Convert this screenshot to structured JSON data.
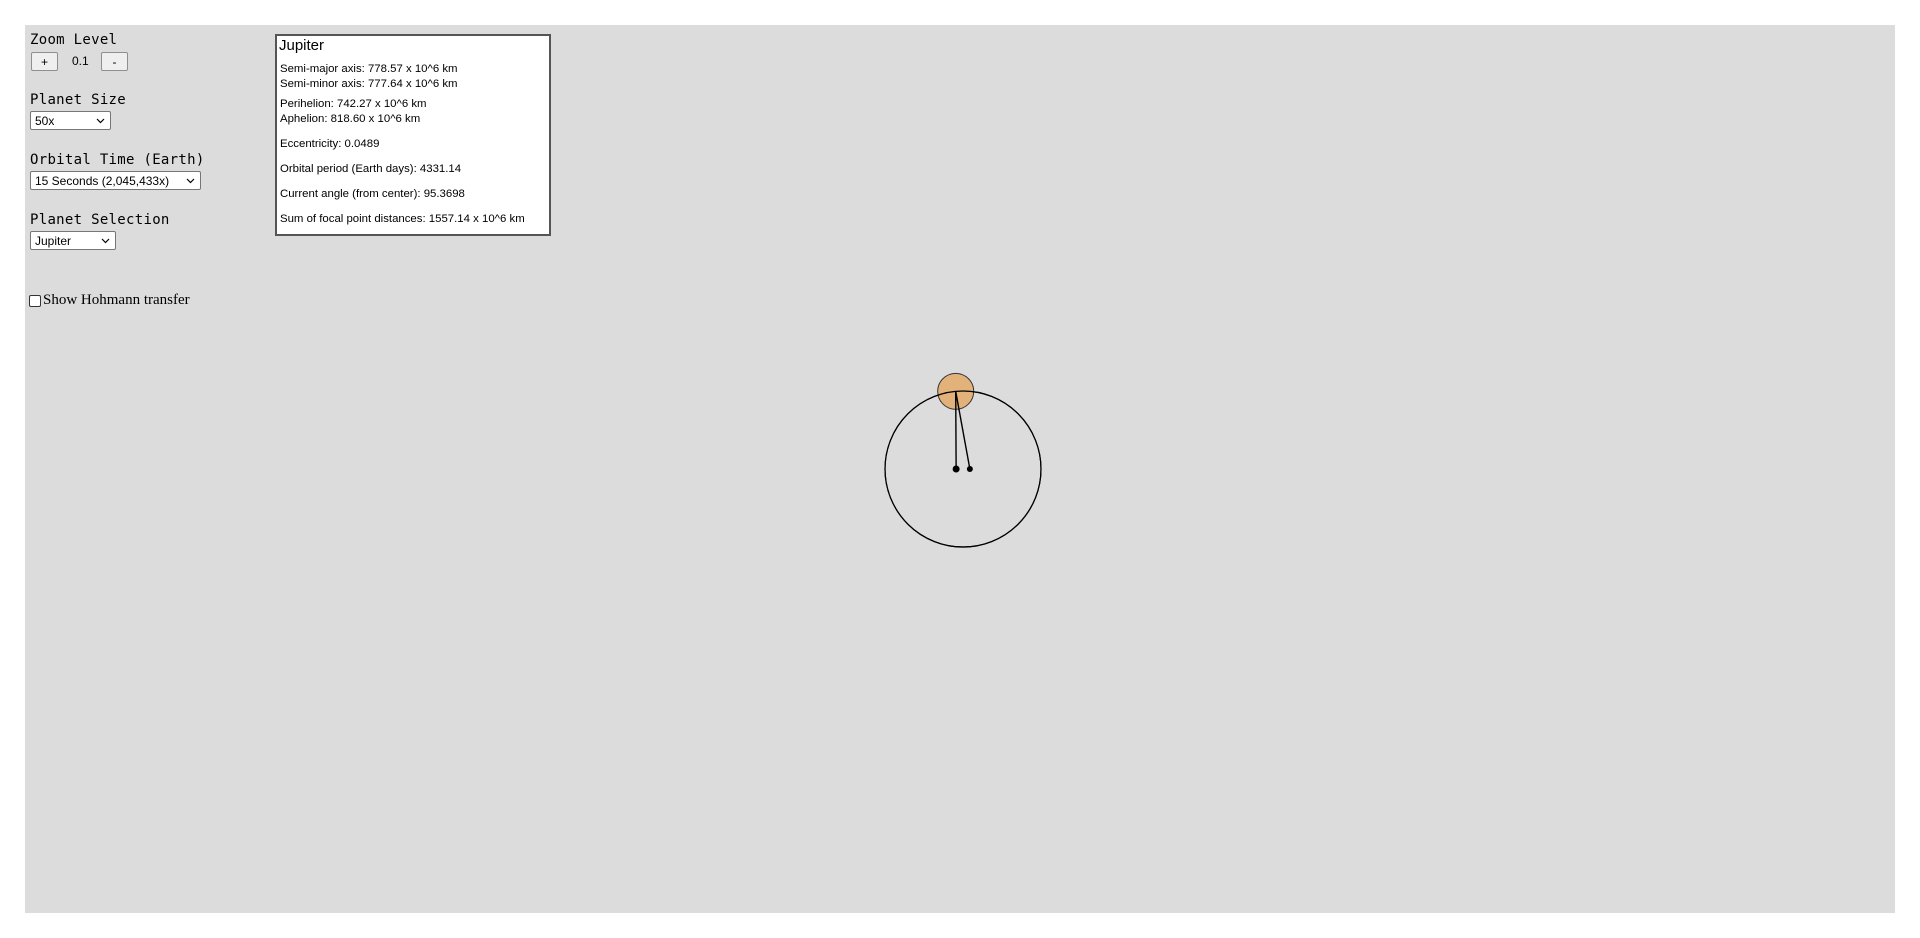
{
  "controls": {
    "zoom": {
      "title": "Zoom Level",
      "plus_label": "+",
      "value": "0.1",
      "minus_label": "-"
    },
    "planet_size": {
      "title": "Planet Size",
      "selected": "50x"
    },
    "orbital_time": {
      "title": "Orbital Time (Earth)",
      "selected": "15 Seconds (2,045,433x)"
    },
    "planet_selection": {
      "title": "Planet Selection",
      "selected": "Jupiter"
    },
    "hohmann": {
      "label": "Show Hohmann transfer",
      "checked": false
    }
  },
  "info_panel": {
    "planet_name": "Jupiter",
    "semi_major": "Semi-major axis: 778.57 x 10^6 km",
    "semi_minor": "Semi-minor axis: 777.64 x 10^6 km",
    "perihelion": "Perihelion: 742.27 x 10^6 km",
    "aphelion": "Aphelion: 818.60 x 10^6 km",
    "eccentricity": "Eccentricity: 0.0489",
    "orbital_period": "Orbital period (Earth days): 4331.14",
    "current_angle": "Current angle (from center): 95.3698",
    "focal_sum": "Sum of focal point distances: 1557.14 x 10^6 km"
  },
  "orbit_model": {
    "planet_color": "#e3b27a",
    "orbit_color": "#000000",
    "eccentricity": 0.0489,
    "current_angle_deg": 95.3698
  }
}
